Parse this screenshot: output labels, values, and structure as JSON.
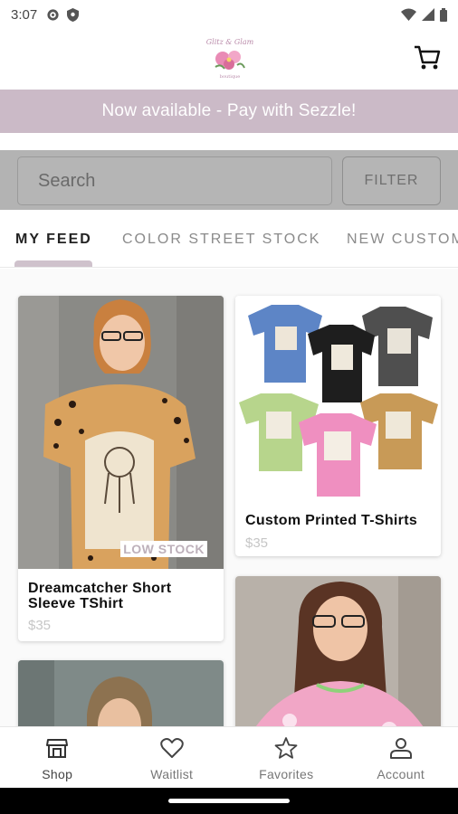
{
  "status_bar": {
    "time": "3:07"
  },
  "header": {
    "logo_icon": "floral-boutique-logo",
    "cart_icon": "cart-icon"
  },
  "promo": {
    "text": "Now available - Pay with Sezzle!"
  },
  "search": {
    "placeholder": "Search",
    "filter_label": "FILTER"
  },
  "tabs": [
    {
      "label": "MY FEED",
      "active": true
    },
    {
      "label": "COLOR STREET STOCK",
      "active": false
    },
    {
      "label": "NEW CUSTOM",
      "active": false
    }
  ],
  "products": [
    {
      "title": "Dreamcatcher  Short Sleeve TShirt",
      "price": "$35",
      "badge": "LOW STOCK",
      "image": "girl-in-leopard-dreamcatcher-shirt"
    },
    {
      "title": "Custom Printed T-Shirts",
      "price": "$35",
      "image": "bleached-blank-tshirts"
    },
    {
      "title": "",
      "price": "",
      "image": "woman-photo-partial"
    },
    {
      "title": "",
      "price": "",
      "image": "girl-in-pink-shirt-partial"
    }
  ],
  "bottom_nav": [
    {
      "label": "Shop",
      "icon": "shop-icon",
      "active": true
    },
    {
      "label": "Waitlist",
      "icon": "heart-icon",
      "active": false
    },
    {
      "label": "Favorites",
      "icon": "star-icon",
      "active": false
    },
    {
      "label": "Account",
      "icon": "person-icon",
      "active": false
    }
  ],
  "colors": {
    "accent": "#cbbac7",
    "search_bg": "#b3b3b3"
  }
}
